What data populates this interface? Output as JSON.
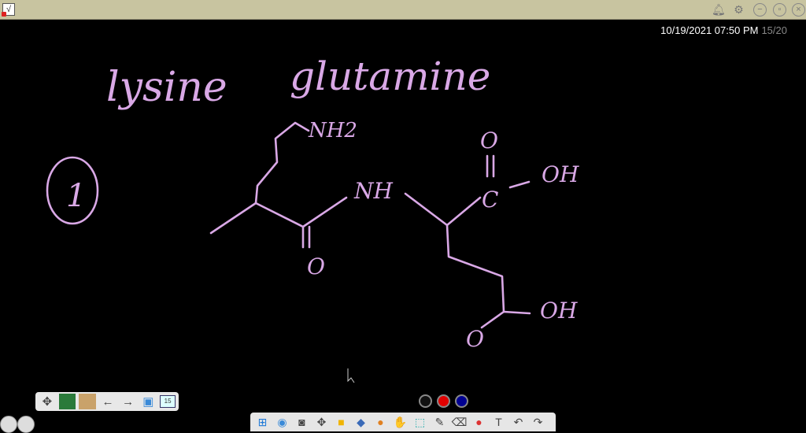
{
  "titlebar": {
    "icons": [
      "app-icon",
      "bell-icon",
      "gear-icon",
      "minimize-icon",
      "restore-icon",
      "close-icon"
    ]
  },
  "status": {
    "datetime": "10/19/2021 07:50 PM",
    "page": "15/20"
  },
  "board": {
    "ink_color": "#d9a8e6",
    "words": {
      "w1": "lysine",
      "w2": "glutamine"
    },
    "labels": {
      "nh2": "NH2",
      "nh": "NH",
      "o1": "O",
      "o2": "O",
      "o3": "O",
      "c": "C",
      "oh1": "OH",
      "oh2": "OH",
      "num": "1"
    }
  },
  "nav_toolbar": {
    "page_badge": "15"
  },
  "colors": {
    "black": "#111111",
    "red": "#e00000",
    "blue": "#000090"
  }
}
